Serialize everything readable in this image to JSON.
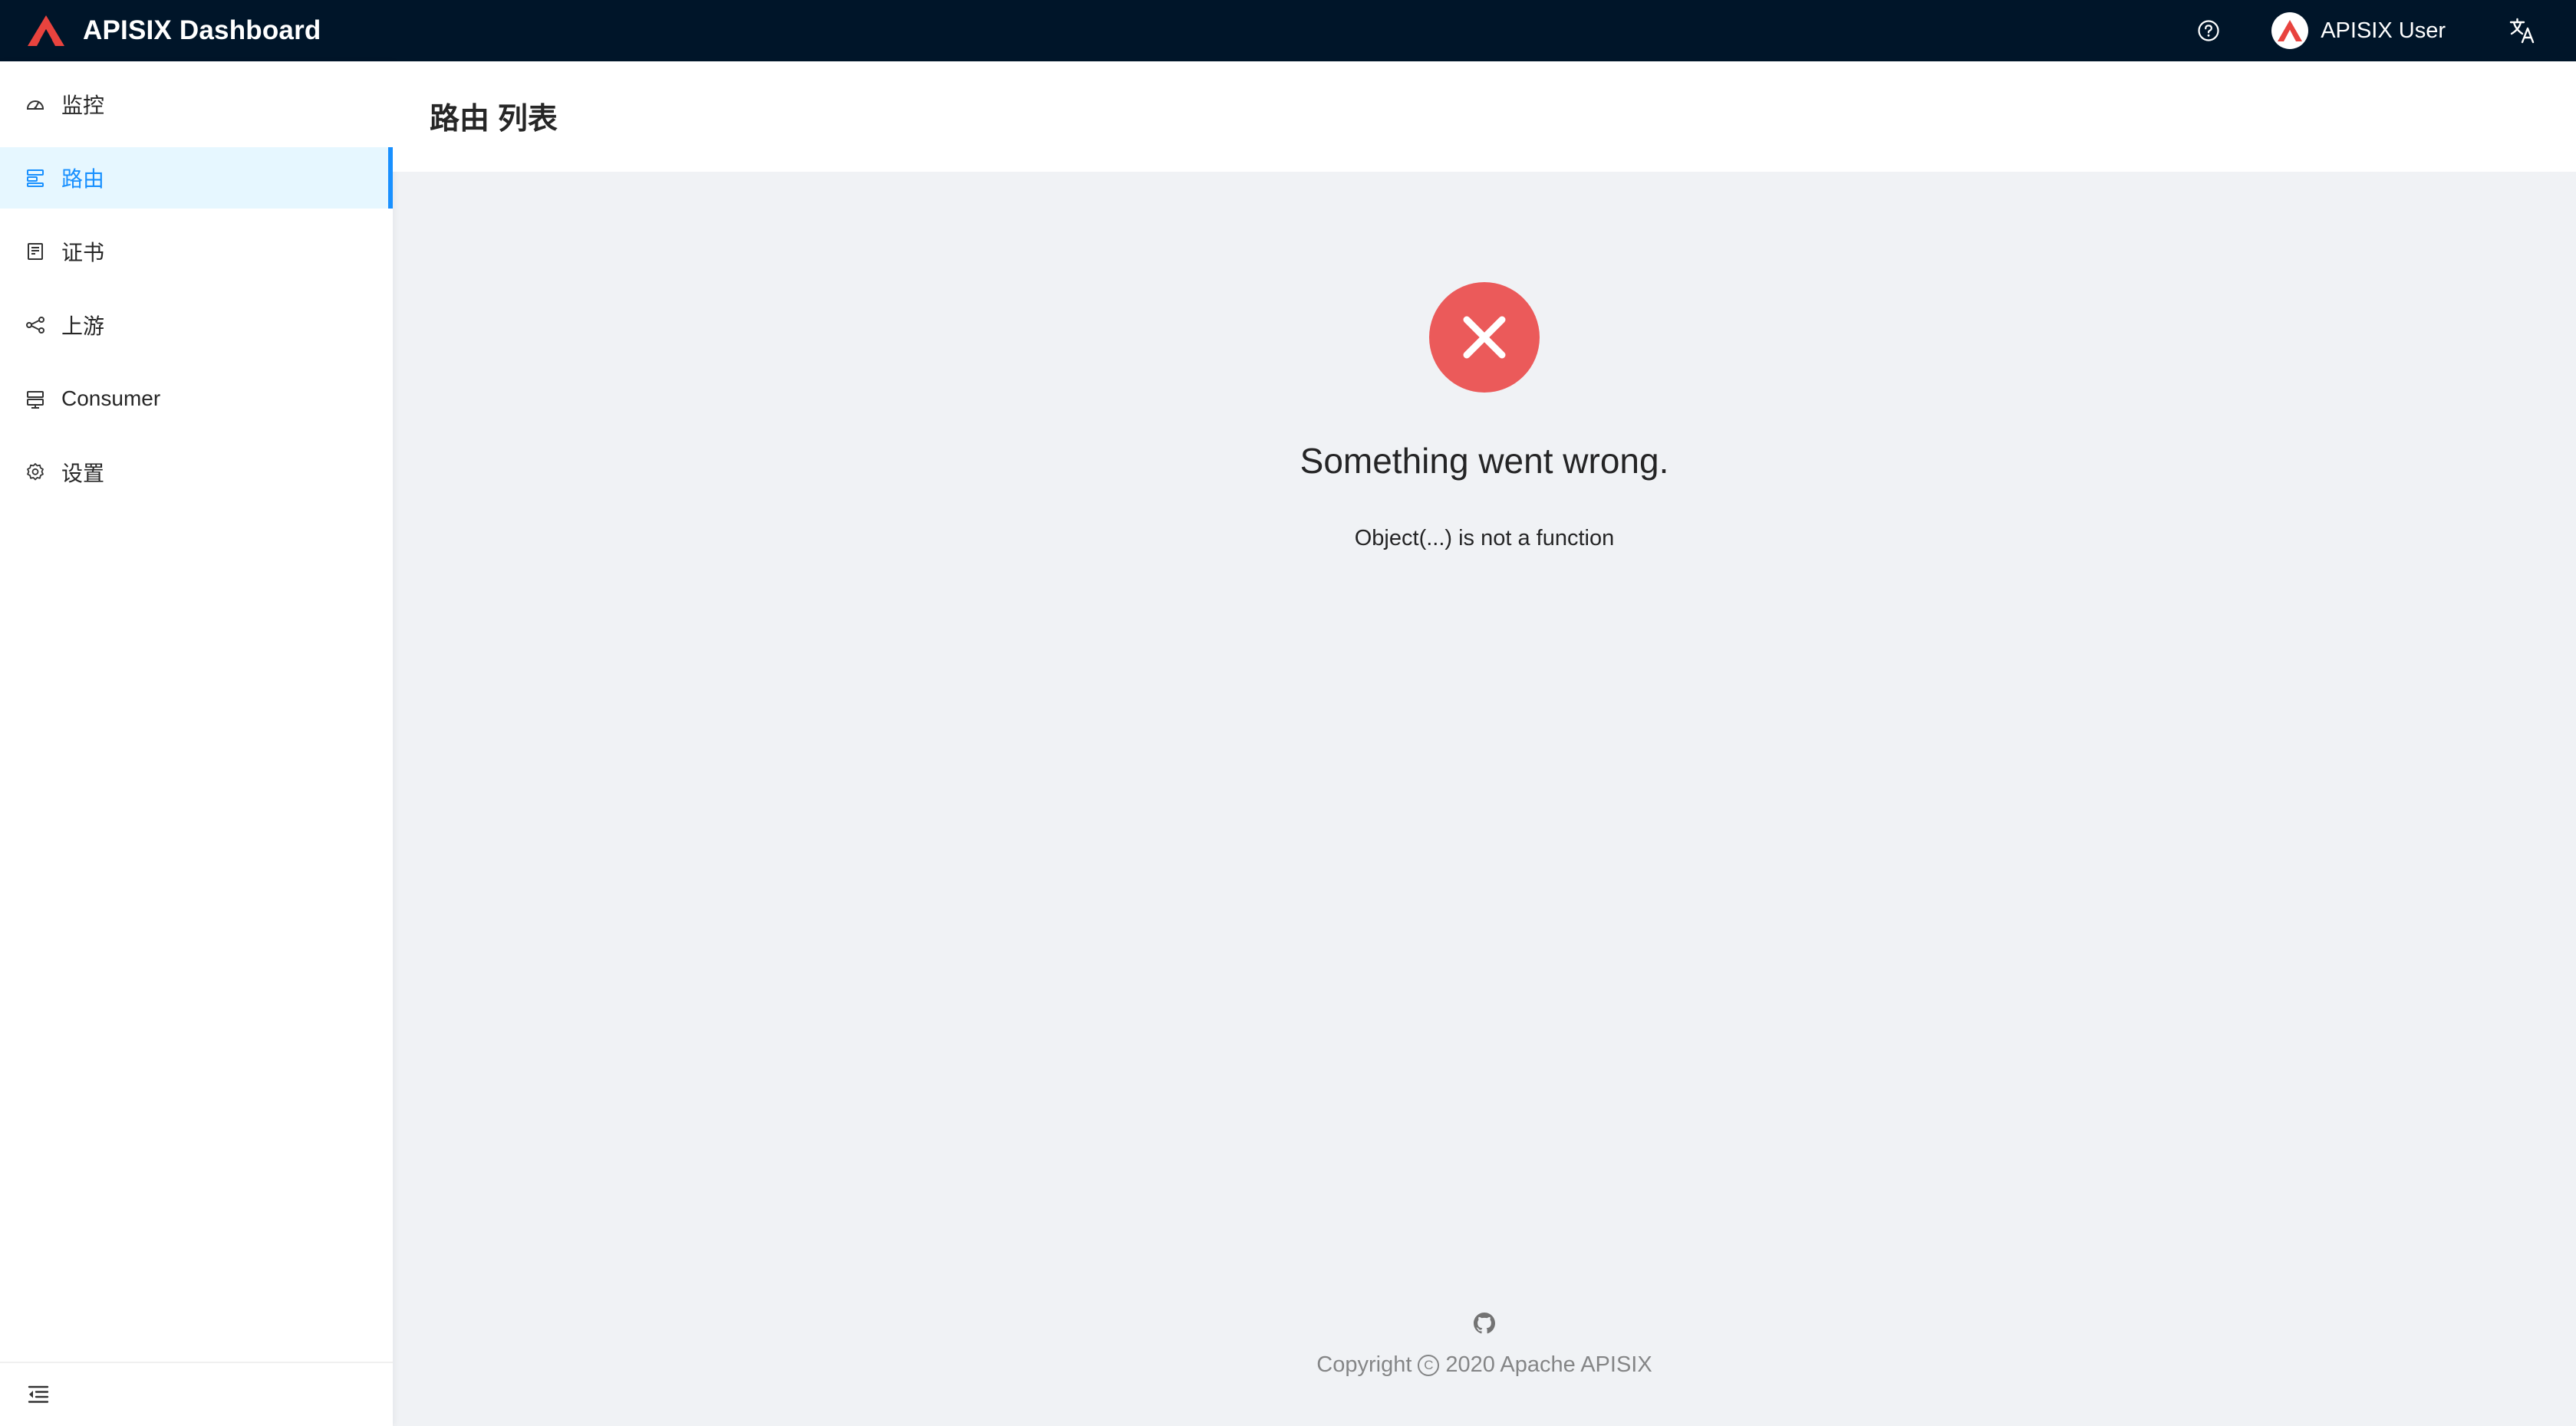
{
  "app": {
    "title": "APISIX Dashboard"
  },
  "header": {
    "help_icon": "question-circle-icon",
    "user": {
      "name": "APISIX User",
      "avatar_icon": "apisix-logo"
    },
    "language_icon": "translation-icon"
  },
  "sidebar": {
    "items": [
      {
        "label": "监控",
        "icon": "dashboard-icon",
        "active": false
      },
      {
        "label": "路由",
        "icon": "route-icon",
        "active": true
      },
      {
        "label": "证书",
        "icon": "certificate-icon",
        "active": false
      },
      {
        "label": "上游",
        "icon": "upstream-icon",
        "active": false
      },
      {
        "label": "Consumer",
        "icon": "consumer-icon",
        "active": false
      },
      {
        "label": "设置",
        "icon": "settings-icon",
        "active": false
      }
    ],
    "collapse_icon": "menu-fold-icon"
  },
  "page": {
    "title": "路由 列表"
  },
  "result": {
    "status": "error",
    "icon": "close-circle-icon",
    "title": "Something went wrong.",
    "subtitle": "Object(...) is not a function"
  },
  "footer": {
    "github_icon": "github-icon",
    "copyright_prefix": "Copyright",
    "copyright_suffix": "2020 Apache APISIX"
  },
  "colors": {
    "header_bg": "#001529",
    "accent": "#1890ff",
    "error": "#eb5a5a",
    "logo_red": "#e8433e"
  }
}
